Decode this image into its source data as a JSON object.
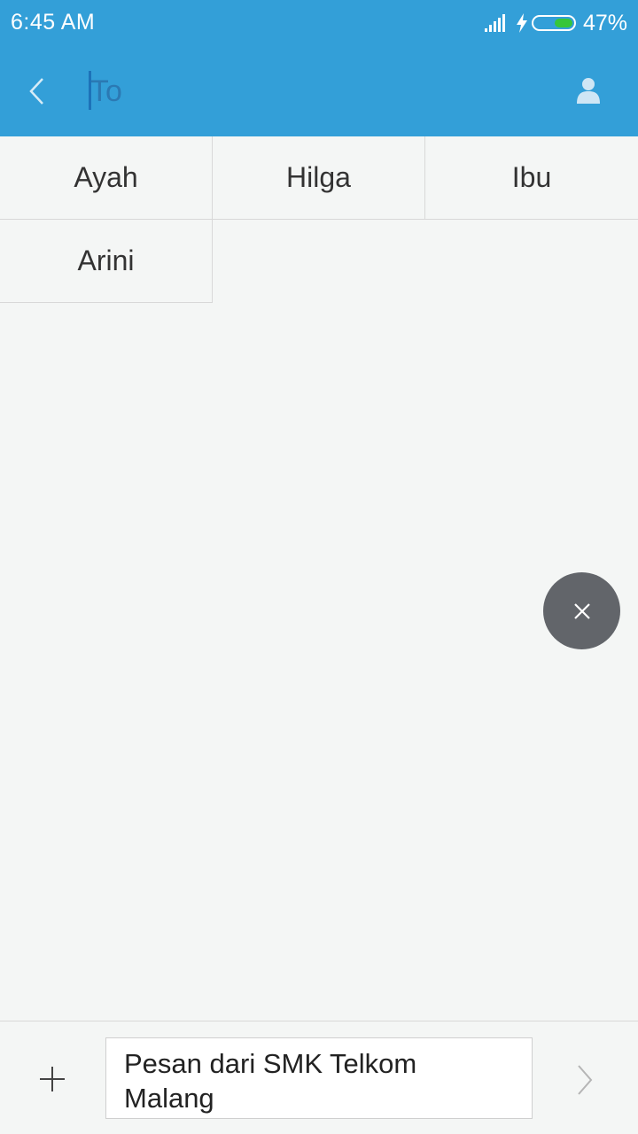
{
  "status_bar": {
    "time": "6:45  AM",
    "battery_percent": "47%",
    "battery_level": 0.47,
    "icons": [
      "signal-icon",
      "charging-bolt-icon",
      "battery-icon"
    ]
  },
  "app_bar": {
    "to_placeholder": "To",
    "back_icon": "chevron-left-icon",
    "contact_icon": "person-icon",
    "accent_color": "#339fd8"
  },
  "contacts": [
    {
      "name": "Ayah"
    },
    {
      "name": "Hilga"
    },
    {
      "name": "Ibu"
    },
    {
      "name": "Arini"
    }
  ],
  "fab": {
    "icon": "close-icon",
    "color": "#62656a"
  },
  "compose": {
    "message": "Pesan dari SMK Telkom Malang",
    "attach_icon": "plus-icon",
    "send_icon": "chevron-right-icon"
  }
}
